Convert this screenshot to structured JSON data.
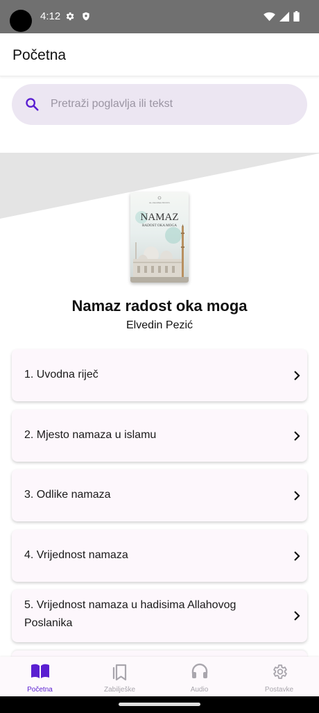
{
  "status_bar": {
    "time": "4:12",
    "icons": [
      "camera-cutout",
      "gear-icon",
      "shield-icon",
      "wifi-icon",
      "signal-icon",
      "battery-icon"
    ]
  },
  "app_bar": {
    "title": "Početna"
  },
  "search": {
    "placeholder": "Pretraži poglavlja ili tekst",
    "icon": "search-icon"
  },
  "book": {
    "title": "Namaz radost oka moga",
    "author": "Elvedin Pezić",
    "cover": {
      "publisher_text": "EL-KELIMEH BOOKS",
      "cover_title": "NAMAZ",
      "cover_subtitle": "RADOST OKA MOGA"
    }
  },
  "chapters": [
    {
      "label": "1. Uvodna riječ"
    },
    {
      "label": "2. Mjesto namaza u islamu"
    },
    {
      "label": "3. Odlike namaza"
    },
    {
      "label": "4. Vrijednost namaza"
    },
    {
      "label": "5. Vrijednost namaza u hadisima Allahovog Poslanika"
    }
  ],
  "bottom_nav": [
    {
      "label": "Početna",
      "icon": "book-open-icon",
      "active": true
    },
    {
      "label": "Zabilješke",
      "icon": "bookmarks-icon",
      "active": false
    },
    {
      "label": "Audio",
      "icon": "headphones-icon",
      "active": false
    },
    {
      "label": "Postavke",
      "icon": "settings-icon",
      "active": false
    }
  ],
  "colors": {
    "accent": "#5a1fd1",
    "search_bg": "#ece6f2",
    "card_bg": "#fdf7fc",
    "status_bar": "#707070",
    "hero_grey": "#e4e4e4",
    "inactive_nav": "#a9a6ad"
  }
}
